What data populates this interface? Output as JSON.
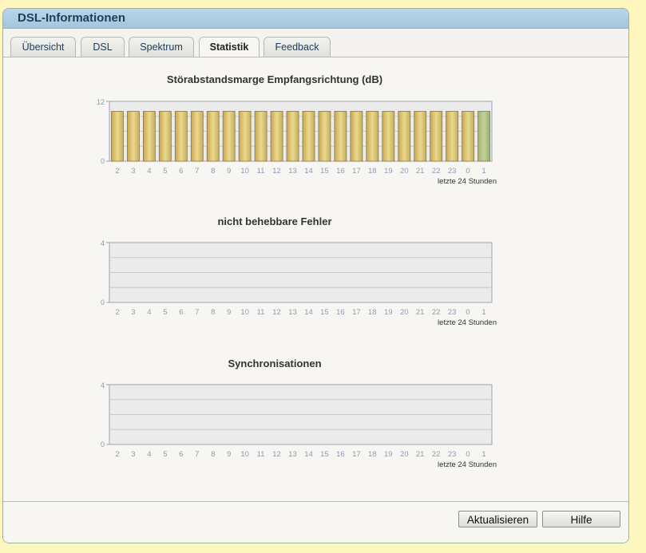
{
  "window": {
    "title": "DSL-Informationen"
  },
  "tabs": [
    {
      "label": "Übersicht",
      "active": false
    },
    {
      "label": "DSL",
      "active": false
    },
    {
      "label": "Spektrum",
      "active": false
    },
    {
      "label": "Statistik",
      "active": true
    },
    {
      "label": "Feedback",
      "active": false
    }
  ],
  "footer": {
    "refresh_label": "Aktualisieren",
    "help_label": "Hilfe"
  },
  "colors": {
    "bar_fill": "#d6bf6b",
    "bar_last": "#a9bf7d",
    "plot_bg": "#ebebeb"
  },
  "chart_data": [
    {
      "type": "bar",
      "title": "Störabstandsmarge Empfangsrichtung (dB)",
      "categories": [
        "2",
        "3",
        "4",
        "5",
        "6",
        "7",
        "8",
        "9",
        "10",
        "11",
        "12",
        "13",
        "14",
        "15",
        "16",
        "17",
        "18",
        "19",
        "20",
        "21",
        "22",
        "23",
        "0",
        "1"
      ],
      "values": [
        10,
        10,
        10,
        10,
        10,
        10,
        10,
        10,
        10,
        10,
        10,
        10,
        10,
        10,
        10,
        10,
        10,
        10,
        10,
        10,
        10,
        10,
        10,
        10
      ],
      "ylim": [
        0,
        12
      ],
      "yticks": [
        "0",
        "12"
      ],
      "xlabel": "letzte 24 Stunden"
    },
    {
      "type": "bar",
      "title": "nicht behebbare Fehler",
      "categories": [
        "2",
        "3",
        "4",
        "5",
        "6",
        "7",
        "8",
        "9",
        "10",
        "11",
        "12",
        "13",
        "14",
        "15",
        "16",
        "17",
        "18",
        "19",
        "20",
        "21",
        "22",
        "23",
        "0",
        "1"
      ],
      "values": [
        0,
        0,
        0,
        0,
        0,
        0,
        0,
        0,
        0,
        0,
        0,
        0,
        0,
        0,
        0,
        0,
        0,
        0,
        0,
        0,
        0,
        0,
        0,
        0
      ],
      "ylim": [
        0,
        4
      ],
      "yticks": [
        "0",
        "4"
      ],
      "xlabel": "letzte 24 Stunden"
    },
    {
      "type": "bar",
      "title": "Synchronisationen",
      "categories": [
        "2",
        "3",
        "4",
        "5",
        "6",
        "7",
        "8",
        "9",
        "10",
        "11",
        "12",
        "13",
        "14",
        "15",
        "16",
        "17",
        "18",
        "19",
        "20",
        "21",
        "22",
        "23",
        "0",
        "1"
      ],
      "values": [
        0,
        0,
        0,
        0,
        0,
        0,
        0,
        0,
        0,
        0,
        0,
        0,
        0,
        0,
        0,
        0,
        0,
        0,
        0,
        0,
        0,
        0,
        0,
        0
      ],
      "ylim": [
        0,
        4
      ],
      "yticks": [
        "0",
        "4"
      ],
      "xlabel": "letzte 24 Stunden"
    }
  ]
}
